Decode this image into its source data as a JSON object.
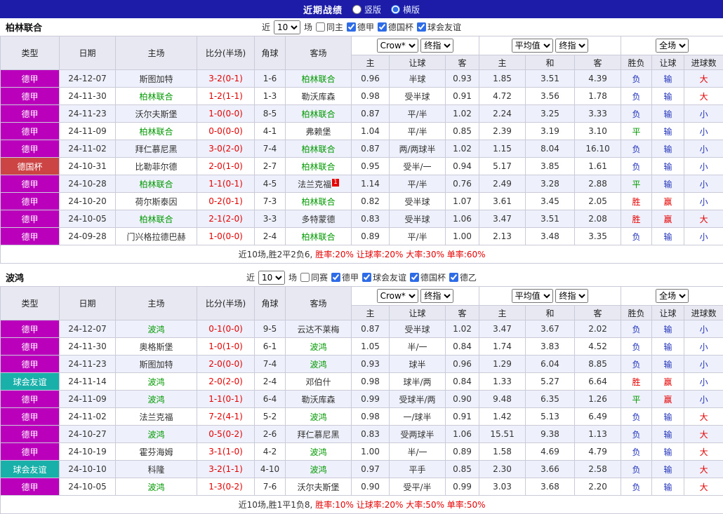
{
  "topbar": {
    "title": "近期战绩",
    "options": [
      {
        "label": "竖版",
        "selected": false
      },
      {
        "label": "横版",
        "selected": true
      }
    ]
  },
  "league_colors": {
    "德甲": "#bb00bb",
    "德国杯": "#cc4444",
    "球会友谊": "#19b0aa",
    "德乙": "#bb00bb"
  },
  "result_colors": {
    "胜": "#e60000",
    "平": "#009900",
    "负": "#2233bb",
    "赢": "#e60000",
    "输": "#2233bb",
    "大": "#e60000",
    "小": "#2233bb"
  },
  "sections": [
    {
      "team": "柏林联合",
      "filter": {
        "prefix": "近",
        "count": "10",
        "suffix": "场",
        "same_label": "同主",
        "same_checked": false,
        "leagues": [
          {
            "label": "德甲",
            "checked": true
          },
          {
            "label": "德国杯",
            "checked": true
          },
          {
            "label": "球会友谊",
            "checked": true
          }
        ]
      },
      "odds_dropdowns": {
        "asia": [
          "Crow*",
          "终指"
        ],
        "euro": [
          "平均值",
          "终指"
        ],
        "result": [
          "全场"
        ]
      },
      "left_columns": [
        "类型",
        "日期",
        "主场",
        "比分(半场)",
        "角球",
        "客场"
      ],
      "sub_columns": [
        "主",
        "让球",
        "客",
        "主",
        "和",
        "客",
        "胜负",
        "让球",
        "进球数"
      ],
      "rows": [
        {
          "league": "德甲",
          "date": "24-12-07",
          "home": "斯图加特",
          "score": "3-2(0-1)",
          "corner": "1-6",
          "away": "柏林联合",
          "asia": [
            "0.96",
            "半球",
            "0.93"
          ],
          "euro": [
            "1.85",
            "3.51",
            "4.39"
          ],
          "results": [
            "负",
            "输",
            "大"
          ]
        },
        {
          "league": "德甲",
          "date": "24-11-30",
          "home": "柏林联合",
          "score": "1-2(1-1)",
          "corner": "1-3",
          "away": "勒沃库森",
          "asia": [
            "0.98",
            "受半球",
            "0.91"
          ],
          "euro": [
            "4.72",
            "3.56",
            "1.78"
          ],
          "results": [
            "负",
            "输",
            "大"
          ]
        },
        {
          "league": "德甲",
          "date": "24-11-23",
          "home": "沃尔夫斯堡",
          "score": "1-0(0-0)",
          "corner": "8-5",
          "away": "柏林联合",
          "asia": [
            "0.87",
            "平/半",
            "1.02"
          ],
          "euro": [
            "2.24",
            "3.25",
            "3.33"
          ],
          "results": [
            "负",
            "输",
            "小"
          ]
        },
        {
          "league": "德甲",
          "date": "24-11-09",
          "home": "柏林联合",
          "score": "0-0(0-0)",
          "corner": "4-1",
          "away": "弗赖堡",
          "asia": [
            "1.04",
            "平/半",
            "0.85"
          ],
          "euro": [
            "2.39",
            "3.19",
            "3.10"
          ],
          "results": [
            "平",
            "输",
            "小"
          ]
        },
        {
          "league": "德甲",
          "date": "24-11-02",
          "home": "拜仁慕尼黑",
          "score": "3-0(2-0)",
          "corner": "7-4",
          "away": "柏林联合",
          "asia": [
            "0.87",
            "两/两球半",
            "1.02"
          ],
          "euro": [
            "1.15",
            "8.04",
            "16.10"
          ],
          "results": [
            "负",
            "输",
            "小"
          ]
        },
        {
          "league": "德国杯",
          "date": "24-10-31",
          "home": "比勒菲尔德",
          "score": "2-0(1-0)",
          "corner": "2-7",
          "away": "柏林联合",
          "asia": [
            "0.95",
            "受半/一",
            "0.94"
          ],
          "euro": [
            "5.17",
            "3.85",
            "1.61"
          ],
          "results": [
            "负",
            "输",
            "小"
          ]
        },
        {
          "league": "德甲",
          "date": "24-10-28",
          "home": "柏林联合",
          "score": "1-1(0-1)",
          "corner": "4-5",
          "away": "法兰克福",
          "away_badge": "1",
          "asia": [
            "1.14",
            "平/半",
            "0.76"
          ],
          "euro": [
            "2.49",
            "3.28",
            "2.88"
          ],
          "results": [
            "平",
            "输",
            "小"
          ]
        },
        {
          "league": "德甲",
          "date": "24-10-20",
          "home": "荷尔斯泰因",
          "score": "0-2(0-1)",
          "corner": "7-3",
          "away": "柏林联合",
          "asia": [
            "0.82",
            "受半球",
            "1.07"
          ],
          "euro": [
            "3.61",
            "3.45",
            "2.05"
          ],
          "results": [
            "胜",
            "赢",
            "小"
          ]
        },
        {
          "league": "德甲",
          "date": "24-10-05",
          "home": "柏林联合",
          "score": "2-1(2-0)",
          "corner": "3-3",
          "away": "多特蒙德",
          "asia": [
            "0.83",
            "受半球",
            "1.06"
          ],
          "euro": [
            "3.47",
            "3.51",
            "2.08"
          ],
          "results": [
            "胜",
            "赢",
            "大"
          ]
        },
        {
          "league": "德甲",
          "date": "24-09-28",
          "home": "门兴格拉德巴赫",
          "score": "1-0(0-0)",
          "corner": "2-4",
          "away": "柏林联合",
          "asia": [
            "0.89",
            "平/半",
            "1.00"
          ],
          "euro": [
            "2.13",
            "3.48",
            "3.35"
          ],
          "results": [
            "负",
            "输",
            "小"
          ]
        }
      ],
      "summary_lead": "近10场,胜2平2负6,",
      "summary_stats": "胜率:20% 让球率:20% 大率:30% 单率:60%"
    },
    {
      "team": "波鸿",
      "filter": {
        "prefix": "近",
        "count": "10",
        "suffix": "场",
        "same_label": "同赛",
        "same_checked": false,
        "leagues": [
          {
            "label": "德甲",
            "checked": true
          },
          {
            "label": "球会友谊",
            "checked": true
          },
          {
            "label": "德国杯",
            "checked": true
          },
          {
            "label": "德乙",
            "checked": true
          }
        ]
      },
      "odds_dropdowns": {
        "asia": [
          "Crow*",
          "终指"
        ],
        "euro": [
          "平均值",
          "终指"
        ],
        "result": [
          "全场"
        ]
      },
      "left_columns": [
        "类型",
        "日期",
        "主场",
        "比分(半场)",
        "角球",
        "客场"
      ],
      "sub_columns": [
        "主",
        "让球",
        "客",
        "主",
        "和",
        "客",
        "胜负",
        "让球",
        "进球数"
      ],
      "rows": [
        {
          "league": "德甲",
          "date": "24-12-07",
          "home": "波鸿",
          "score": "0-1(0-0)",
          "corner": "9-5",
          "away": "云达不莱梅",
          "asia": [
            "0.87",
            "受半球",
            "1.02"
          ],
          "euro": [
            "3.47",
            "3.67",
            "2.02"
          ],
          "results": [
            "负",
            "输",
            "小"
          ]
        },
        {
          "league": "德甲",
          "date": "24-11-30",
          "home": "奥格斯堡",
          "score": "1-0(1-0)",
          "corner": "6-1",
          "away": "波鸿",
          "asia": [
            "1.05",
            "半/一",
            "0.84"
          ],
          "euro": [
            "1.74",
            "3.83",
            "4.52"
          ],
          "results": [
            "负",
            "输",
            "小"
          ]
        },
        {
          "league": "德甲",
          "date": "24-11-23",
          "home": "斯图加特",
          "score": "2-0(0-0)",
          "corner": "7-4",
          "away": "波鸿",
          "asia": [
            "0.93",
            "球半",
            "0.96"
          ],
          "euro": [
            "1.29",
            "6.04",
            "8.85"
          ],
          "results": [
            "负",
            "输",
            "小"
          ]
        },
        {
          "league": "球会友谊",
          "date": "24-11-14",
          "home": "波鸿",
          "score": "2-0(2-0)",
          "corner": "2-4",
          "away": "邓伯什",
          "asia": [
            "0.98",
            "球半/两",
            "0.84"
          ],
          "euro": [
            "1.33",
            "5.27",
            "6.64"
          ],
          "results": [
            "胜",
            "赢",
            "小"
          ]
        },
        {
          "league": "德甲",
          "date": "24-11-09",
          "home": "波鸿",
          "score": "1-1(0-1)",
          "corner": "6-4",
          "away": "勒沃库森",
          "asia": [
            "0.99",
            "受球半/两",
            "0.90"
          ],
          "euro": [
            "9.48",
            "6.35",
            "1.26"
          ],
          "results": [
            "平",
            "赢",
            "小"
          ]
        },
        {
          "league": "德甲",
          "date": "24-11-02",
          "home": "法兰克福",
          "score": "7-2(4-1)",
          "corner": "5-2",
          "away": "波鸿",
          "asia": [
            "0.98",
            "一/球半",
            "0.91"
          ],
          "euro": [
            "1.42",
            "5.13",
            "6.49"
          ],
          "results": [
            "负",
            "输",
            "大"
          ]
        },
        {
          "league": "德甲",
          "date": "24-10-27",
          "home": "波鸿",
          "score": "0-5(0-2)",
          "corner": "2-6",
          "away": "拜仁慕尼黑",
          "asia": [
            "0.83",
            "受两球半",
            "1.06"
          ],
          "euro": [
            "15.51",
            "9.38",
            "1.13"
          ],
          "results": [
            "负",
            "输",
            "大"
          ]
        },
        {
          "league": "德甲",
          "date": "24-10-19",
          "home": "霍芬海姆",
          "score": "3-1(1-0)",
          "corner": "4-2",
          "away": "波鸿",
          "asia": [
            "1.00",
            "半/一",
            "0.89"
          ],
          "euro": [
            "1.58",
            "4.69",
            "4.79"
          ],
          "results": [
            "负",
            "输",
            "大"
          ]
        },
        {
          "league": "球会友谊",
          "date": "24-10-10",
          "home": "科隆",
          "score": "3-2(1-1)",
          "corner": "4-10",
          "away": "波鸿",
          "asia": [
            "0.97",
            "平手",
            "0.85"
          ],
          "euro": [
            "2.30",
            "3.66",
            "2.58"
          ],
          "results": [
            "负",
            "输",
            "大"
          ]
        },
        {
          "league": "德甲",
          "date": "24-10-05",
          "home": "波鸿",
          "score": "1-3(0-2)",
          "corner": "7-6",
          "away": "沃尔夫斯堡",
          "asia": [
            "0.90",
            "受平/半",
            "0.99"
          ],
          "euro": [
            "3.03",
            "3.68",
            "2.20"
          ],
          "results": [
            "负",
            "输",
            "大"
          ]
        }
      ],
      "summary_lead": "近10场,胜1平1负8,",
      "summary_stats": "胜率:10% 让球率:20% 大率:50% 单率:50%"
    }
  ]
}
